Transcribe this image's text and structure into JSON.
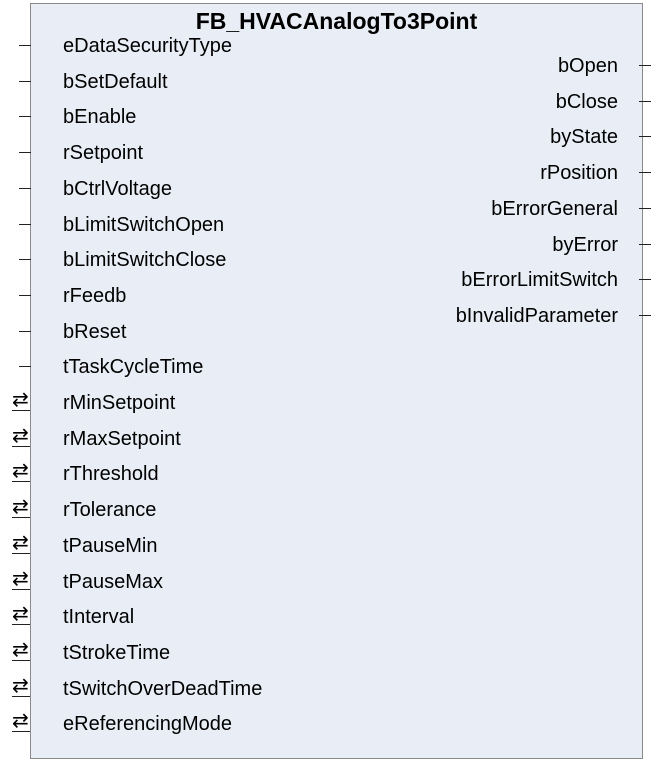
{
  "block": {
    "title": "FB_HVACAnalogTo3Point"
  },
  "inputs": [
    {
      "name": "eDataSecurityType",
      "kind": "input"
    },
    {
      "name": "bSetDefault",
      "kind": "input"
    },
    {
      "name": "bEnable",
      "kind": "input"
    },
    {
      "name": "rSetpoint",
      "kind": "input"
    },
    {
      "name": "bCtrlVoltage",
      "kind": "input"
    },
    {
      "name": "bLimitSwitchOpen",
      "kind": "input"
    },
    {
      "name": "bLimitSwitchClose",
      "kind": "input"
    },
    {
      "name": "rFeedb",
      "kind": "input"
    },
    {
      "name": "bReset",
      "kind": "input"
    },
    {
      "name": "tTaskCycleTime",
      "kind": "input"
    },
    {
      "name": "rMinSetpoint",
      "kind": "inout"
    },
    {
      "name": "rMaxSetpoint",
      "kind": "inout"
    },
    {
      "name": "rThreshold",
      "kind": "inout"
    },
    {
      "name": "rTolerance",
      "kind": "inout"
    },
    {
      "name": "tPauseMin",
      "kind": "inout"
    },
    {
      "name": "tPauseMax",
      "kind": "inout"
    },
    {
      "name": "tInterval",
      "kind": "inout"
    },
    {
      "name": "tStrokeTime",
      "kind": "inout"
    },
    {
      "name": "tSwitchOverDeadTime",
      "kind": "inout"
    },
    {
      "name": "eReferencingMode",
      "kind": "inout"
    }
  ],
  "outputs": [
    {
      "name": "bOpen"
    },
    {
      "name": "bClose"
    },
    {
      "name": "byState"
    },
    {
      "name": "rPosition"
    },
    {
      "name": "bErrorGeneral"
    },
    {
      "name": "byError"
    },
    {
      "name": "bErrorLimitSwitch"
    },
    {
      "name": "bInvalidParameter"
    }
  ],
  "icons": {
    "inout": "bidirectional-arrow-icon",
    "input": "input-pin-line",
    "output": "output-pin-line"
  },
  "colors": {
    "block_fill": "#e9eef6",
    "block_border": "#8a8a8a",
    "text": "#000000"
  }
}
